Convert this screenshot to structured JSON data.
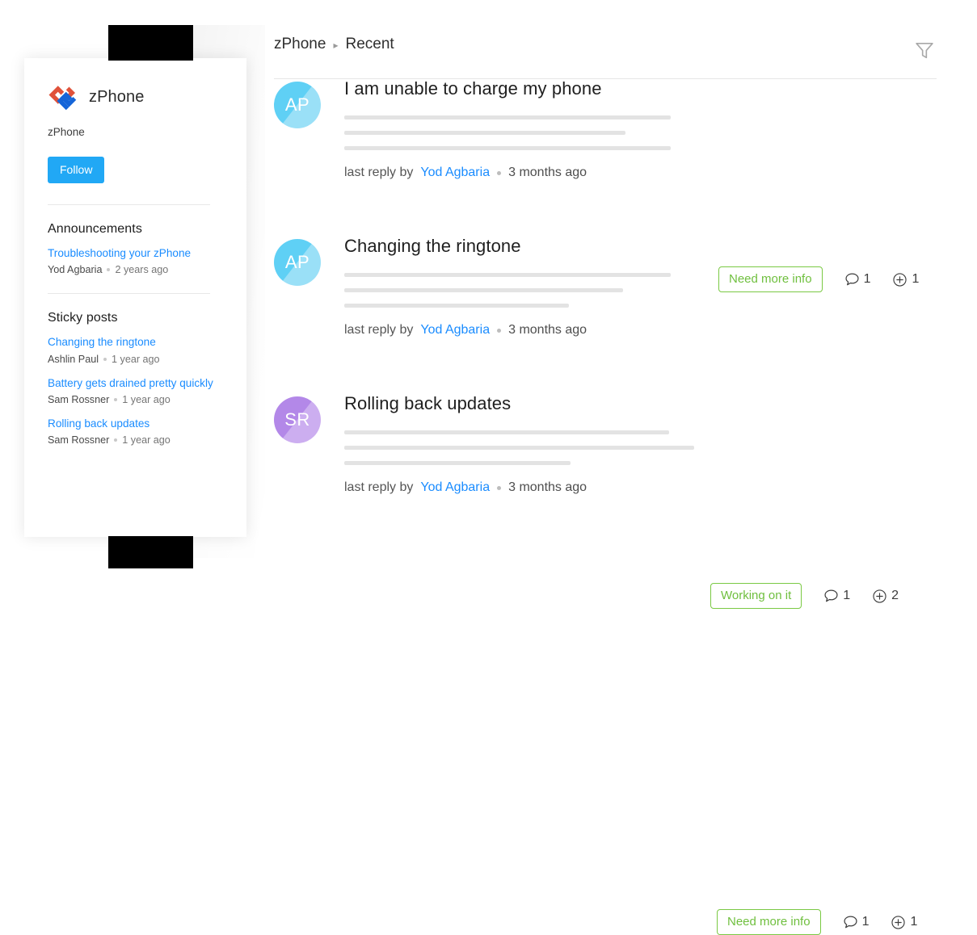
{
  "theme": {
    "link_blue": "#1a8cff",
    "accent_blue": "#21a8f5",
    "badge_green": "#6fbf3e",
    "badge_border_green": "#7ac943",
    "skeleton_gray": "#e3e3e3"
  },
  "sidebar": {
    "logo_icon": "zphone-logo-icon",
    "brand_name": "zPhone",
    "brand_subtitle": "zPhone",
    "follow_label": "Follow",
    "sections": [
      {
        "id": "announcements",
        "title": "Announcements",
        "items": [
          {
            "title": "Troubleshooting your zPhone",
            "author": "Yod Agbaria",
            "time": "2 years ago"
          }
        ]
      },
      {
        "id": "sticky-posts",
        "title": "Sticky posts",
        "items": [
          {
            "title": "Changing the ringtone",
            "author": "Ashlin Paul",
            "time": "1 year ago"
          },
          {
            "title": "Battery gets drained pretty quickly",
            "author": "Sam Rossner",
            "time": "1 year ago"
          },
          {
            "title": "Rolling back updates",
            "author": "Sam Rossner",
            "time": "1 year ago"
          }
        ]
      }
    ]
  },
  "header": {
    "breadcrumb": {
      "root": "zPhone",
      "separator": "▸",
      "current": "Recent"
    },
    "filter_icon": "filter-funnel-icon"
  },
  "posts": [
    {
      "avatar_initials": "AP",
      "avatar_color": "#5fd0f5",
      "avatar_color_light": "#9ae0f7",
      "title": "I am unable to charge my phone",
      "last_reply_prefix": "last reply by",
      "last_reply_author": "Yod Agbaria",
      "last_reply_time": "3 months ago",
      "status": "Need more info",
      "comment_icon": "comment-bubble-icon",
      "comment_count": "1",
      "follower_icon": "plus-circle-icon",
      "follower_count": "1"
    },
    {
      "avatar_initials": "AP",
      "avatar_color": "#5fd0f5",
      "avatar_color_light": "#9ae0f7",
      "title": "Changing the ringtone",
      "last_reply_prefix": "last reply by",
      "last_reply_author": "Yod Agbaria",
      "last_reply_time": "3 months ago",
      "status": "Working on it",
      "comment_icon": "comment-bubble-icon",
      "comment_count": "1",
      "follower_icon": "plus-circle-icon",
      "follower_count": "2"
    },
    {
      "avatar_initials": "SR",
      "avatar_color": "#b388e8",
      "avatar_color_light": "#ccaef0",
      "title": "Rolling back updates",
      "last_reply_prefix": "last reply by",
      "last_reply_author": "Yod Agbaria",
      "last_reply_time": "3 months ago",
      "status": "Need more info",
      "comment_icon": "comment-bubble-icon",
      "comment_count": "1",
      "follower_icon": "plus-circle-icon",
      "follower_count": "1"
    }
  ]
}
